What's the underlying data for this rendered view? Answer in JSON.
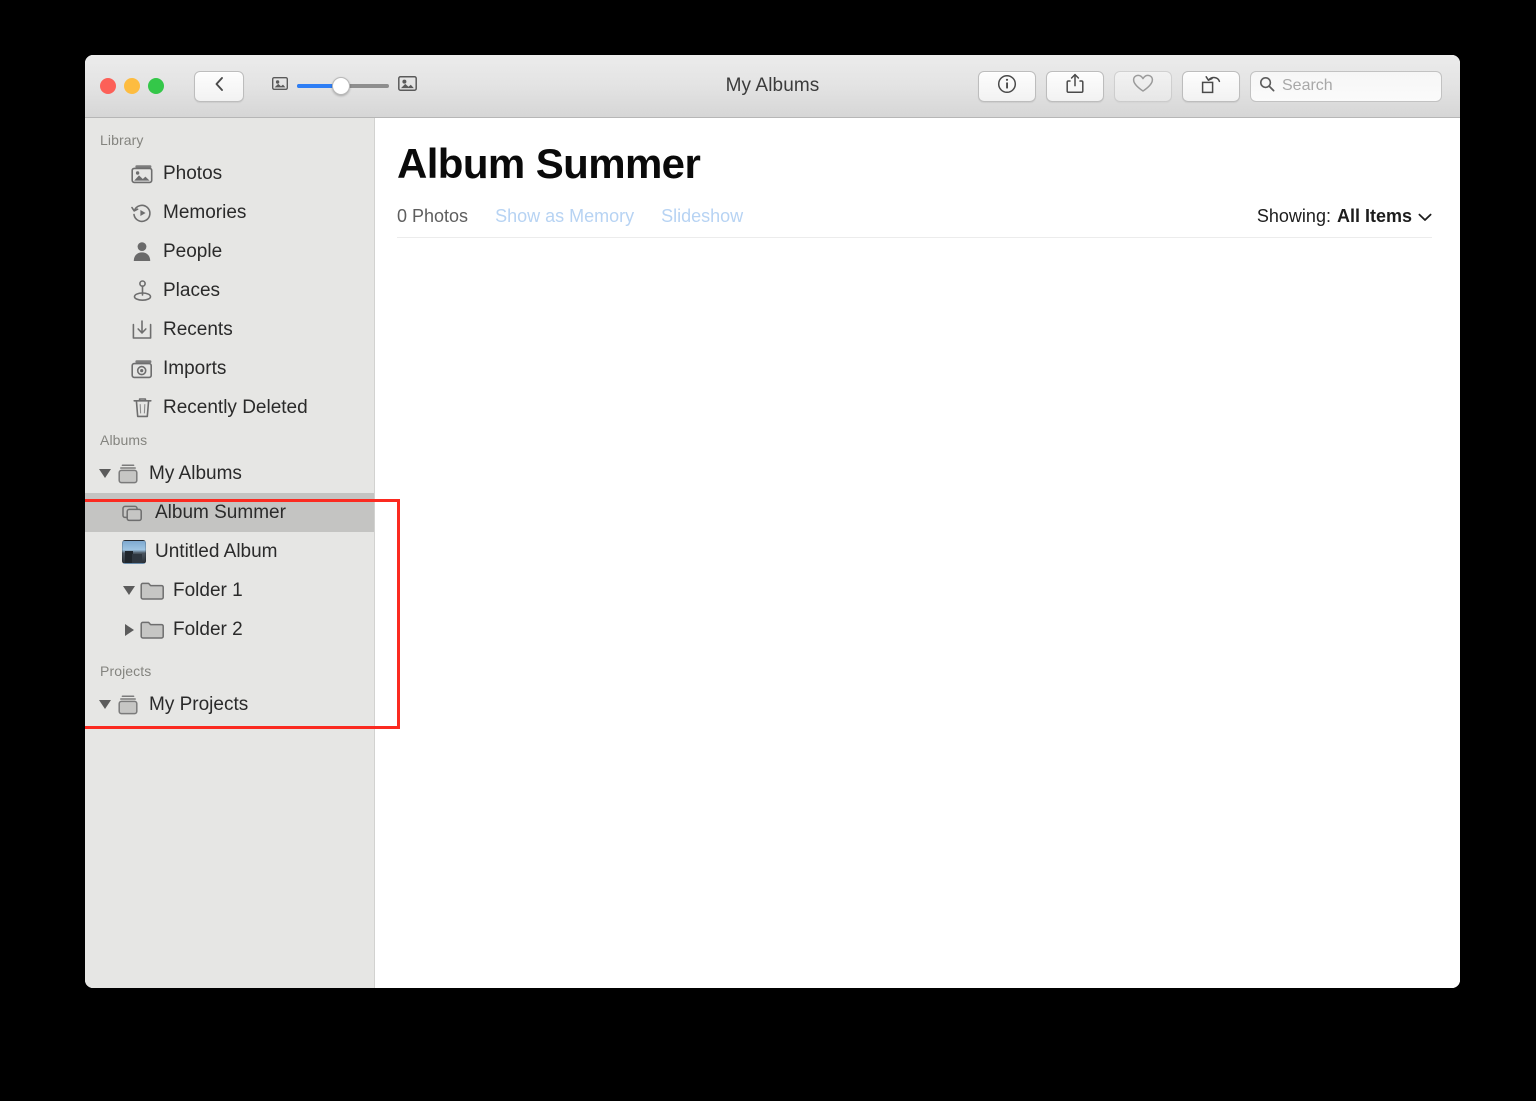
{
  "window": {
    "title": "My Albums",
    "traffic_lights": [
      "close",
      "minimize",
      "maximize"
    ]
  },
  "toolbar": {
    "back_icon": "chevron-left-icon",
    "zoom_out_icon": "small-thumbnail-icon",
    "zoom_in_icon": "large-thumbnail-icon",
    "zoom_value_percent": 48,
    "info_icon": "info-circle-icon",
    "share_icon": "share-upload-icon",
    "favorite_icon": "heart-icon",
    "rotate_icon": "rotate-counterclockwise-icon",
    "search": {
      "icon": "search-icon",
      "placeholder": "Search",
      "value": ""
    },
    "accent_color": "#2e7ef5"
  },
  "sidebar": {
    "sections": [
      {
        "header": "Library",
        "items": [
          {
            "label": "Photos",
            "icon": "photos-stack-icon"
          },
          {
            "label": "Memories",
            "icon": "memories-play-icon"
          },
          {
            "label": "People",
            "icon": "person-icon"
          },
          {
            "label": "Places",
            "icon": "map-pin-icon"
          },
          {
            "label": "Recents",
            "icon": "download-tray-icon"
          },
          {
            "label": "Imports",
            "icon": "camera-stack-icon"
          },
          {
            "label": "Recently Deleted",
            "icon": "trash-icon"
          }
        ]
      },
      {
        "header": "Albums",
        "items": [
          {
            "label": "My Albums",
            "icon": "album-box-icon",
            "disclosure": "down",
            "indent": 0,
            "selected": false
          },
          {
            "label": "Album Summer",
            "icon": "album-stack-icon",
            "disclosure": "none",
            "indent": 1,
            "selected": true
          },
          {
            "label": "Untitled Album",
            "icon": "photo-thumbnail",
            "disclosure": "none",
            "indent": 1,
            "selected": false
          },
          {
            "label": "Folder 1",
            "icon": "folder-icon",
            "disclosure": "down",
            "indent": 1,
            "selected": false
          },
          {
            "label": "Folder 2",
            "icon": "folder-icon",
            "disclosure": "right",
            "indent": 1,
            "selected": false
          }
        ]
      },
      {
        "header": "Projects",
        "items": [
          {
            "label": "My Projects",
            "icon": "album-box-icon",
            "disclosure": "down",
            "indent": 0,
            "selected": false
          }
        ]
      }
    ],
    "selection_color": "#c4c4c2",
    "background_color": "#e6e6e4"
  },
  "annotation": {
    "highlight_color": "#fb2a20",
    "target_section": "Albums"
  },
  "content": {
    "album_title": "Album Summer",
    "photo_count": "0 Photos",
    "show_as_memory": "Show as Memory",
    "slideshow": "Slideshow",
    "showing_label": "Showing:",
    "showing_value": "All Items",
    "showing_chevron_icon": "chevron-down-icon",
    "disabled_link_color": "#b7d3f3"
  }
}
